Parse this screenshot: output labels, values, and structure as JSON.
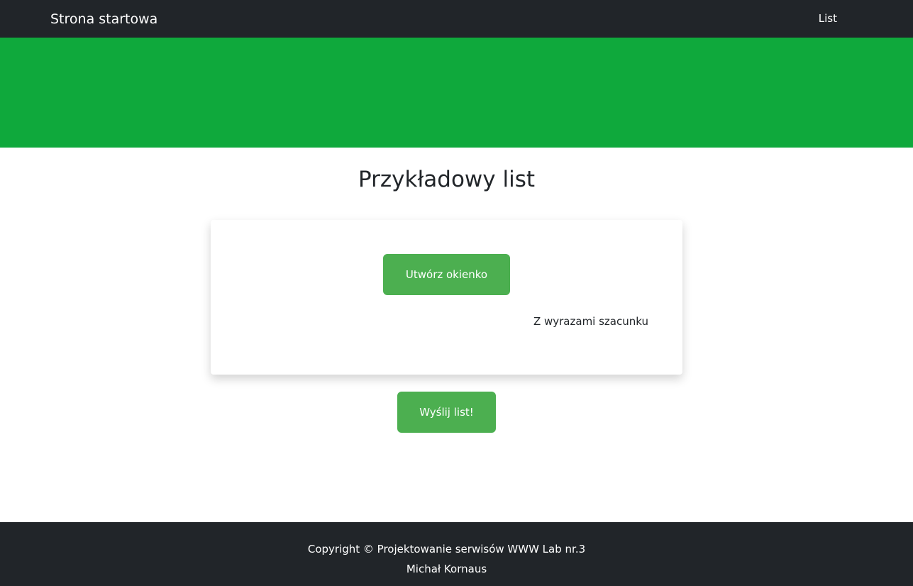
{
  "navbar": {
    "brand": "Strona startowa",
    "link_label": "List"
  },
  "hero": {
    "color": "#0fa93c"
  },
  "main": {
    "title": "Przykładowy list",
    "card": {
      "create_button_label": "Utwórz okienko",
      "signature": "Z wyrazami szacunku"
    },
    "send_button_label": "Wyślij list!"
  },
  "footer": {
    "copyright": "Copyright © Projektowanie serwisów WWW Lab nr.3",
    "author": "Michał Kornaus"
  },
  "colors": {
    "navbar_bg": "#212529",
    "button_bg": "#4caf50",
    "text": "#212529"
  }
}
